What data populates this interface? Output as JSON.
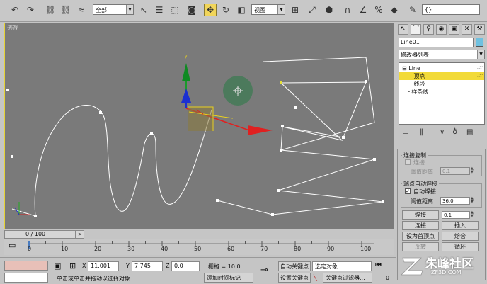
{
  "toolbar": {
    "selection_filter": "全部",
    "ref_coord": "视图",
    "named_selection": "{}"
  },
  "viewport": {
    "label": "透视"
  },
  "panel": {
    "object_name": "Line01",
    "object_color": "#6fc1e0",
    "modifier_list": "修改器列表",
    "stack": {
      "root": "Line",
      "items": [
        "顶点",
        "线段",
        "样条线"
      ]
    }
  },
  "rollout": {
    "connect_copy": {
      "title": "连接复制",
      "connect_label": "连接",
      "threshold_label": "阈值距离",
      "threshold_value": "0.1"
    },
    "end_weld": {
      "title": "端点自动焊接",
      "auto_weld_label": "自动焊接",
      "threshold_label": "阈值距离",
      "threshold_value": "36.0"
    },
    "weld_button": "焊接",
    "weld_value": "0.1",
    "connect_button": "连接",
    "insert_button": "插入",
    "set_first_button": "设为首顶点",
    "fuse_button": "熔合",
    "reverse_button": "反转",
    "cycle_button": "循环"
  },
  "timeline": {
    "slider": "0 / 100",
    "ticks": [
      "0",
      "10",
      "20",
      "30",
      "40",
      "50",
      "60",
      "70",
      "80",
      "90",
      "100"
    ]
  },
  "status": {
    "prompt": "单击或单击并拖动以选择对象",
    "x_label": "X",
    "x_value": "11.001",
    "y_label": "Y",
    "y_value": "7.745",
    "z_label": "Z",
    "z_value": "0.0",
    "grid": "栅格 = 10.0",
    "add_time_tag": "添加时间标记",
    "auto_key": "自动关键点",
    "set_key": "设置关键点",
    "key_mode": "选定对象",
    "key_filters": "关键点过滤器...",
    "frame": "0"
  },
  "watermark": {
    "brand": "朱峰社区",
    "url": "ZF3D.COM"
  },
  "colors": {
    "viewport_bg": "#7a7a7a",
    "active_border": "#e5d338",
    "stack_selected": "#f2da38"
  }
}
